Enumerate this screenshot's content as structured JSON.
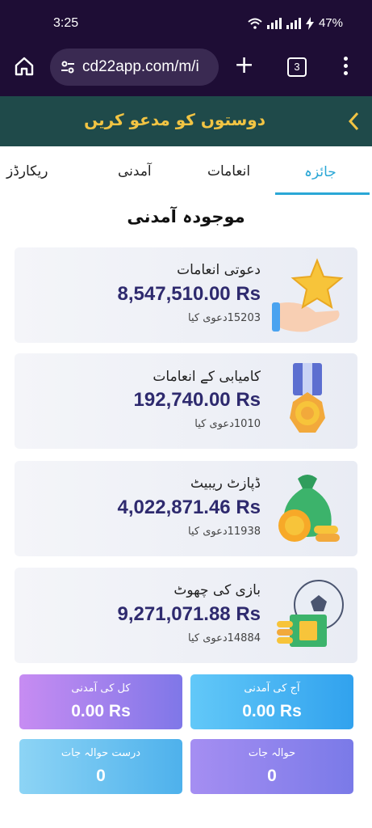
{
  "status_bar": {
    "time": "3:25",
    "battery": "47%"
  },
  "browser": {
    "url": "cd22app.com/m/i",
    "tab_count": "3"
  },
  "invite_banner": {
    "label": "دوستوں کو مدعو کریں"
  },
  "tabs": [
    {
      "label": "جائزہ",
      "active": true
    },
    {
      "label": "انعامات",
      "active": false
    },
    {
      "label": "آمدنی",
      "active": false
    },
    {
      "label": "ریکارڈز",
      "active": false
    }
  ],
  "section_title": "موجودہ آمدنی",
  "cards": [
    {
      "title": "دعوتی انعامات",
      "amount": "8,547,510.00 Rs",
      "count": "15203دعوی کیا",
      "icon": "star-hand-icon"
    },
    {
      "title": "کامیابی کے انعامات",
      "amount": "192,740.00 Rs",
      "count": "1010دعوی کیا",
      "icon": "medal-icon"
    },
    {
      "title": "ڈپازٹ ریبیٹ",
      "amount": "4,022,871.46 Rs",
      "count": "11938دعوی کیا",
      "icon": "money-bag-icon"
    },
    {
      "title": "بازی کی چھوٹ",
      "amount": "9,271,071.88 Rs",
      "count": "14884دعوی کیا",
      "icon": "soccer-cash-icon"
    }
  ],
  "stats": {
    "total_income": {
      "label": "کل کی آمدنی",
      "value": "0.00 Rs"
    },
    "today_income": {
      "label": "آج کی آمدنی",
      "value": "0.00 Rs"
    },
    "valid_referrals": {
      "label": "درست حوالہ جات",
      "value": "0"
    },
    "referrals": {
      "label": "حوالہ جات",
      "value": "0"
    }
  },
  "colors": {
    "topbar": "#1e0d35",
    "banner": "#1f4a4a",
    "banner_text": "#f2c443",
    "accent": "#2aa7d6",
    "amount": "#2e2a6e"
  }
}
